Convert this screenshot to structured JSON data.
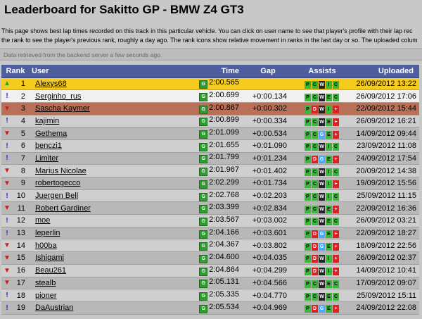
{
  "title": "Leaderboard for Sakitto GP - BMW Z4 GT3",
  "description": [
    "This page shows best lap times recorded on this track in this particular vehicle. You can click on user name to see that player's profile with their lap rec",
    "the rank to see the player's previous rank, roughly a day ago. The rank icons show relative movement in ranks in the last day or so. The uploaded colum"
  ],
  "status": "Data retrieved from the backend server a few seconds ago.",
  "headers": {
    "rank": "Rank",
    "user": "User",
    "time": "Time",
    "gap": "Gap",
    "assists": "Assists",
    "uploaded": "Uploaded"
  },
  "colors": {
    "header": "#4e5e9e",
    "gold": "#f5cc1e",
    "brown": "#b97058"
  },
  "rows": [
    {
      "mv": "up",
      "rank": "1",
      "user": "Alexys68",
      "time": "2:00.565",
      "gap": "",
      "assists": [
        "P",
        "C",
        "W",
        "I",
        "C"
      ],
      "colors": [
        "green",
        "green",
        "dark",
        "green",
        "green"
      ],
      "uploaded": "26/09/2012 13:22",
      "style": "gold"
    },
    {
      "mv": "bang",
      "rank": "2",
      "user": "Serginho_rus",
      "time": "2:00.699",
      "gap": "+0:00.134",
      "assists": [
        "P",
        "C",
        "W",
        "E",
        "C"
      ],
      "colors": [
        "green",
        "green",
        "dark",
        "green",
        "green"
      ],
      "uploaded": "26/09/2012 17:06",
      "style": "self"
    },
    {
      "mv": "down",
      "rank": "3",
      "user": "Sascha Kaymer",
      "time": "2:00.867",
      "gap": "+0:00.302",
      "assists": [
        "P",
        "D",
        "W",
        "I",
        "+"
      ],
      "colors": [
        "green",
        "red",
        "dark",
        "green",
        "plus"
      ],
      "uploaded": "22/09/2012 15:44",
      "style": "brown"
    },
    {
      "mv": "bang",
      "rank": "4",
      "user": "kajimin",
      "time": "2:00.899",
      "gap": "+0:00.334",
      "assists": [
        "P",
        "C",
        "W",
        "E",
        "+"
      ],
      "colors": [
        "green",
        "green",
        "dark",
        "green",
        "plus"
      ],
      "uploaded": "26/09/2012 16:21",
      "style": "alt"
    },
    {
      "mv": "down",
      "rank": "5",
      "user": "Gethema",
      "time": "2:01.099",
      "gap": "+0:00.534",
      "assists": [
        "P",
        "C",
        "G",
        "E",
        "+"
      ],
      "colors": [
        "green",
        "green",
        "blue",
        "green",
        "plus"
      ],
      "uploaded": "14/09/2012 09:44",
      "style": ""
    },
    {
      "mv": "bang",
      "rank": "6",
      "user": "benczi1",
      "time": "2:01.655",
      "gap": "+0:01.090",
      "assists": [
        "P",
        "C",
        "W",
        "I",
        "C"
      ],
      "colors": [
        "green",
        "green",
        "dark",
        "green",
        "green"
      ],
      "uploaded": "23/09/2012 11:08",
      "style": "alt"
    },
    {
      "mv": "bang",
      "rank": "7",
      "user": "Limiter",
      "time": "2:01.799",
      "gap": "+0:01.234",
      "assists": [
        "P",
        "D",
        "G",
        "E",
        "+"
      ],
      "colors": [
        "green",
        "red",
        "blue",
        "green",
        "plus"
      ],
      "uploaded": "24/09/2012 17:54",
      "style": ""
    },
    {
      "mv": "down",
      "rank": "8",
      "user": "Marius Nicolae",
      "time": "2:01.967",
      "gap": "+0:01.402",
      "assists": [
        "P",
        "C",
        "W",
        "I",
        "C"
      ],
      "colors": [
        "green",
        "green",
        "dark",
        "green",
        "green"
      ],
      "uploaded": "20/09/2012 14:38",
      "style": "alt"
    },
    {
      "mv": "down",
      "rank": "9",
      "user": "robertogecco",
      "time": "2:02.299",
      "gap": "+0:01.734",
      "assists": [
        "P",
        "C",
        "W",
        "I",
        "+"
      ],
      "colors": [
        "green",
        "green",
        "dark",
        "green",
        "plus"
      ],
      "uploaded": "19/09/2012 15:56",
      "style": ""
    },
    {
      "mv": "bang",
      "rank": "10",
      "user": "Juergen Bell",
      "time": "2:02.768",
      "gap": "+0:02.203",
      "assists": [
        "P",
        "C",
        "W",
        "I",
        "C"
      ],
      "colors": [
        "green",
        "green",
        "dark",
        "green",
        "green"
      ],
      "uploaded": "25/09/2012 11:15",
      "style": "alt"
    },
    {
      "mv": "down",
      "rank": "11",
      "user": "Robert Gardiner",
      "time": "2:03.399",
      "gap": "+0:02.834",
      "assists": [
        "P",
        "C",
        "W",
        "E",
        "+"
      ],
      "colors": [
        "green",
        "green",
        "dark",
        "green",
        "plus"
      ],
      "uploaded": "22/09/2012 16:36",
      "style": ""
    },
    {
      "mv": "bang",
      "rank": "12",
      "user": "moe",
      "time": "2:03.567",
      "gap": "+0:03.002",
      "assists": [
        "P",
        "C",
        "W",
        "E",
        "C"
      ],
      "colors": [
        "green",
        "green",
        "dark",
        "green",
        "green"
      ],
      "uploaded": "26/09/2012 03:21",
      "style": "alt"
    },
    {
      "mv": "bang",
      "rank": "13",
      "user": "leperlin",
      "time": "2:04.166",
      "gap": "+0:03.601",
      "assists": [
        "P",
        "D",
        "G",
        "E",
        "+"
      ],
      "colors": [
        "green",
        "red",
        "blue",
        "green",
        "plus"
      ],
      "uploaded": "22/09/2012 18:27",
      "style": ""
    },
    {
      "mv": "down",
      "rank": "14",
      "user": "h00ba",
      "time": "2:04.367",
      "gap": "+0:03.802",
      "assists": [
        "P",
        "D",
        "G",
        "E",
        "+"
      ],
      "colors": [
        "green",
        "red",
        "blue",
        "green",
        "plus"
      ],
      "uploaded": "18/09/2012 22:56",
      "style": "alt"
    },
    {
      "mv": "down",
      "rank": "15",
      "user": "Ishigami",
      "time": "2:04.600",
      "gap": "+0:04.035",
      "assists": [
        "P",
        "D",
        "W",
        "I",
        "+"
      ],
      "colors": [
        "green",
        "red",
        "dark",
        "green",
        "plus"
      ],
      "uploaded": "26/09/2012 02:37",
      "style": ""
    },
    {
      "mv": "down",
      "rank": "16",
      "user": "Beau261",
      "time": "2:04.864",
      "gap": "+0:04.299",
      "assists": [
        "P",
        "D",
        "W",
        "I",
        "+"
      ],
      "colors": [
        "green",
        "red",
        "dark",
        "green",
        "plus"
      ],
      "uploaded": "14/09/2012 10:41",
      "style": "alt"
    },
    {
      "mv": "down",
      "rank": "17",
      "user": "stealb",
      "time": "2:05.131",
      "gap": "+0:04.566",
      "assists": [
        "P",
        "C",
        "W",
        "E",
        "C"
      ],
      "colors": [
        "green",
        "green",
        "dark",
        "green",
        "green"
      ],
      "uploaded": "17/09/2012 09:07",
      "style": ""
    },
    {
      "mv": "bang",
      "rank": "18",
      "user": "pioner",
      "time": "2:05.335",
      "gap": "+0:04.770",
      "assists": [
        "P",
        "C",
        "W",
        "E",
        "C"
      ],
      "colors": [
        "green",
        "green",
        "dark",
        "green",
        "green"
      ],
      "uploaded": "25/09/2012 15:11",
      "style": "alt"
    },
    {
      "mv": "bang",
      "rank": "19",
      "user": "DaAustrian",
      "time": "2:05.534",
      "gap": "+0:04.969",
      "assists": [
        "P",
        "D",
        "G",
        "E",
        "+"
      ],
      "colors": [
        "green",
        "red",
        "blue",
        "green",
        "plus"
      ],
      "uploaded": "24/09/2012 22:08",
      "style": ""
    }
  ]
}
